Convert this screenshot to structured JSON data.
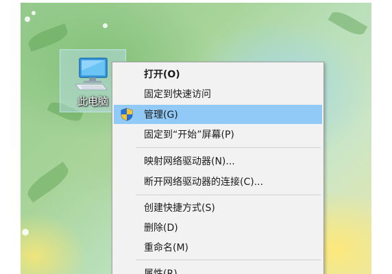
{
  "desktop_icon": {
    "label": "此电脑",
    "icon": "computer-icon"
  },
  "context_menu": {
    "items": [
      {
        "label": "打开(O)",
        "bold": true
      },
      {
        "label": "固定到快速访问"
      },
      {
        "label": "管理(G)",
        "highlighted": true,
        "icon": "uac-shield-icon"
      },
      {
        "label": "固定到“开始”屏幕(P)"
      },
      {
        "label": "映射网络驱动器(N)..."
      },
      {
        "label": "断开网络驱动器的连接(C)..."
      },
      {
        "label": "创建快捷方式(S)"
      },
      {
        "label": "删除(D)"
      },
      {
        "label": "重命名(M)"
      },
      {
        "label": "属性(R)"
      }
    ]
  },
  "colors": {
    "highlight": "#91c9f7",
    "menu_background": "#f2f2f2"
  }
}
